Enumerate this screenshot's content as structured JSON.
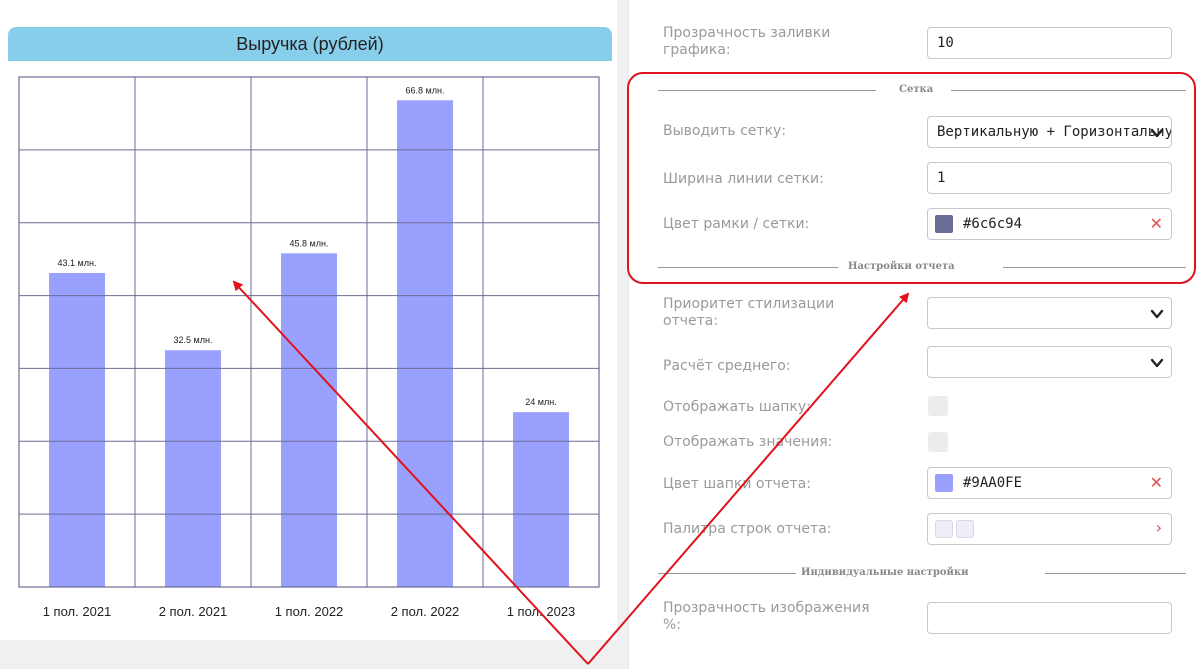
{
  "chart_data": {
    "type": "bar",
    "title": "Выручка (рублей)",
    "categories": [
      "1 пол. 2021",
      "2 пол. 2021",
      "1 пол. 2022",
      "2 пол. 2022",
      "1 пол. 2023"
    ],
    "values": [
      43.1,
      32.5,
      45.8,
      66.8,
      24
    ],
    "value_labels": [
      "43.1 млн.",
      "32.5 млн.",
      "45.8 млн.",
      "66.8 млн.",
      "24 млн."
    ],
    "ylim": [
      0,
      70
    ],
    "grid": "vertical+horizontal",
    "bar_color": "#9aa0fe",
    "grid_color": "#6c6c94",
    "header_color": "#87ceeb"
  },
  "settings": {
    "fill_opacity": {
      "label": "Прозрачность заливки графика:",
      "value": "10"
    },
    "grid_section": {
      "title": "Сетка",
      "show_grid": {
        "label": "Выводить сетку:",
        "value": "Вертикальную + Горизонтальную"
      },
      "grid_line_width": {
        "label": "Ширина линии сетки:",
        "value": "1"
      },
      "frame_grid_color": {
        "label": "Цвет рамки / сетки:",
        "value": "#6c6c94",
        "color": "#6c6c94"
      }
    },
    "report_section": {
      "title": "Настройки отчета",
      "style_priority": {
        "label": "Приоритет стилизации отчета:",
        "value": ""
      },
      "average_calc": {
        "label": "Расчёт среднего:",
        "value": ""
      },
      "show_header": {
        "label": "Отображать шапку:",
        "checked": false
      },
      "show_values": {
        "label": "Отображать значения:",
        "checked": false
      },
      "header_color": {
        "label": "Цвет шапки отчета:",
        "value": "#9AA0FE",
        "color": "#9aa0fe"
      },
      "row_palette": {
        "label": "Палитра строк отчета:"
      }
    },
    "individual_section": {
      "title": "Индивидуальные настройки",
      "image_opacity": {
        "label": "Прозрачность изображения %:",
        "value": ""
      }
    }
  },
  "annotation": {
    "highlight_color": "#e0121b"
  }
}
